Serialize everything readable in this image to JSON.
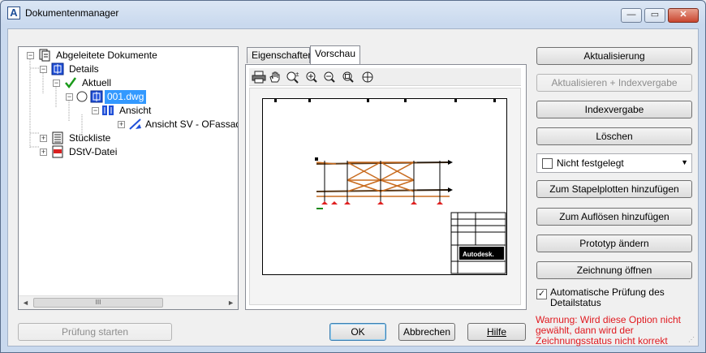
{
  "window": {
    "title": "Dokumentenmanager",
    "accent": "#3399ff"
  },
  "titlebar": {
    "app_icon": "A",
    "min_glyph": "—",
    "max_glyph": "▭",
    "close_glyph": "✕"
  },
  "tree": {
    "items": [
      {
        "label": "Abgeleitete Dokumente",
        "expander": "−"
      },
      {
        "label": "Details",
        "expander": "−"
      },
      {
        "label": "Aktuell",
        "expander": "−"
      },
      {
        "label": "001.dwg",
        "expander": "−"
      },
      {
        "label": "Ansicht",
        "expander": "−"
      },
      {
        "label": "Ansicht SV - OFassade O",
        "expander": "+"
      },
      {
        "label": "Stückliste",
        "expander": "+"
      },
      {
        "label": "DStV-Datei",
        "expander": "+"
      }
    ],
    "scroll_left": "◄",
    "scroll_right": "►",
    "scroll_grip": "III"
  },
  "tabs": [
    {
      "label": "Eigenschaften"
    },
    {
      "label": "Vorschau"
    }
  ],
  "preview_toolbar": [
    "print-icon",
    "pan-icon",
    "zoom-realtime-icon",
    "zoom-in-icon",
    "zoom-out-icon",
    "zoom-window-icon",
    "zoom-extents-icon"
  ],
  "preview": {
    "titleblock_brand": "Autodesk."
  },
  "actions": {
    "update": "Aktualisierung",
    "update_index": "Aktualisieren + Indexvergabe",
    "index": "Indexvergabe",
    "delete": "Löschen",
    "status_select": "Nicht festgelegt",
    "batch_plot": "Zum Stapelplotten hinzufügen",
    "explode": "Zum Auflösen hinzufügen",
    "prototype": "Prototyp ändern",
    "open_drawing": "Zeichnung öffnen"
  },
  "auto_check": {
    "label": "Automatische Prüfung des Detailstatus",
    "checked": true,
    "mark": "✓"
  },
  "warning": {
    "text": "Warnung: Wird diese Option nicht gewählt, dann wird der Zeichnungsstatus nicht korrekt"
  },
  "footer": {
    "start_check": "Prüfung starten",
    "ok": "OK",
    "cancel": "Abbrechen",
    "help": "Hilfe"
  }
}
